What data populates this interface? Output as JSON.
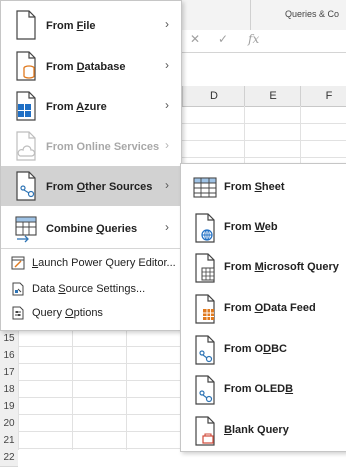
{
  "ribbon": {
    "group_label": "Queries & Co"
  },
  "formula_bar": {
    "cancel_icon": "✕",
    "enter_icon": "✓",
    "fx_label": "fx"
  },
  "sheet": {
    "columns": [
      "D",
      "E",
      "F"
    ],
    "rows": [
      "15",
      "16",
      "17",
      "18",
      "19",
      "20",
      "21",
      "22"
    ]
  },
  "menu": {
    "items": [
      {
        "pre": "From ",
        "u": "F",
        "post": "ile",
        "icon": "file-icon",
        "enabled": true
      },
      {
        "pre": "From ",
        "u": "D",
        "post": "atabase",
        "icon": "database-icon",
        "enabled": true
      },
      {
        "pre": "From ",
        "u": "A",
        "post": "zure",
        "icon": "azure-icon",
        "enabled": true
      },
      {
        "pre": "From Online Services",
        "u": "",
        "post": "",
        "icon": "online-services-icon",
        "enabled": false
      },
      {
        "pre": "From ",
        "u": "O",
        "post": "ther Sources",
        "icon": "other-sources-icon",
        "enabled": true,
        "highlighted": true
      },
      {
        "pre": "Combine ",
        "u": "Q",
        "post": "ueries",
        "icon": "combine-queries-icon",
        "enabled": true
      }
    ],
    "small_items": [
      {
        "pre": "",
        "u": "L",
        "post": "aunch Power Query Editor...",
        "icon": "power-query-editor-icon"
      },
      {
        "pre": "Data ",
        "u": "S",
        "post": "ource Settings...",
        "icon": "data-source-settings-icon"
      },
      {
        "pre": "Query ",
        "u": "O",
        "post": "ptions",
        "icon": "query-options-icon"
      }
    ]
  },
  "submenu": {
    "items": [
      {
        "pre": "From ",
        "u": "S",
        "post": "heet",
        "icon": "sheet-table-icon"
      },
      {
        "pre": "From ",
        "u": "W",
        "post": "eb",
        "icon": "web-globe-icon"
      },
      {
        "pre": "From ",
        "u": "M",
        "post": "icrosoft Query",
        "icon": "microsoft-query-icon"
      },
      {
        "pre": "From ",
        "u": "O",
        "post": "Data Feed",
        "icon": "odata-feed-icon"
      },
      {
        "pre": "From O",
        "u": "D",
        "post": "BC",
        "icon": "odbc-icon"
      },
      {
        "pre": "From OLED",
        "u": "B",
        "post": "",
        "icon": "oledb-icon"
      },
      {
        "pre": "",
        "u": "B",
        "post": "lank Query",
        "icon": "blank-query-icon"
      }
    ]
  },
  "colors": {
    "highlight": "#d2d2d2",
    "orange": "#e07a1f",
    "azure_blue": "#1f6fc5",
    "link_blue": "#2e74b5",
    "red": "#d04a3a"
  }
}
